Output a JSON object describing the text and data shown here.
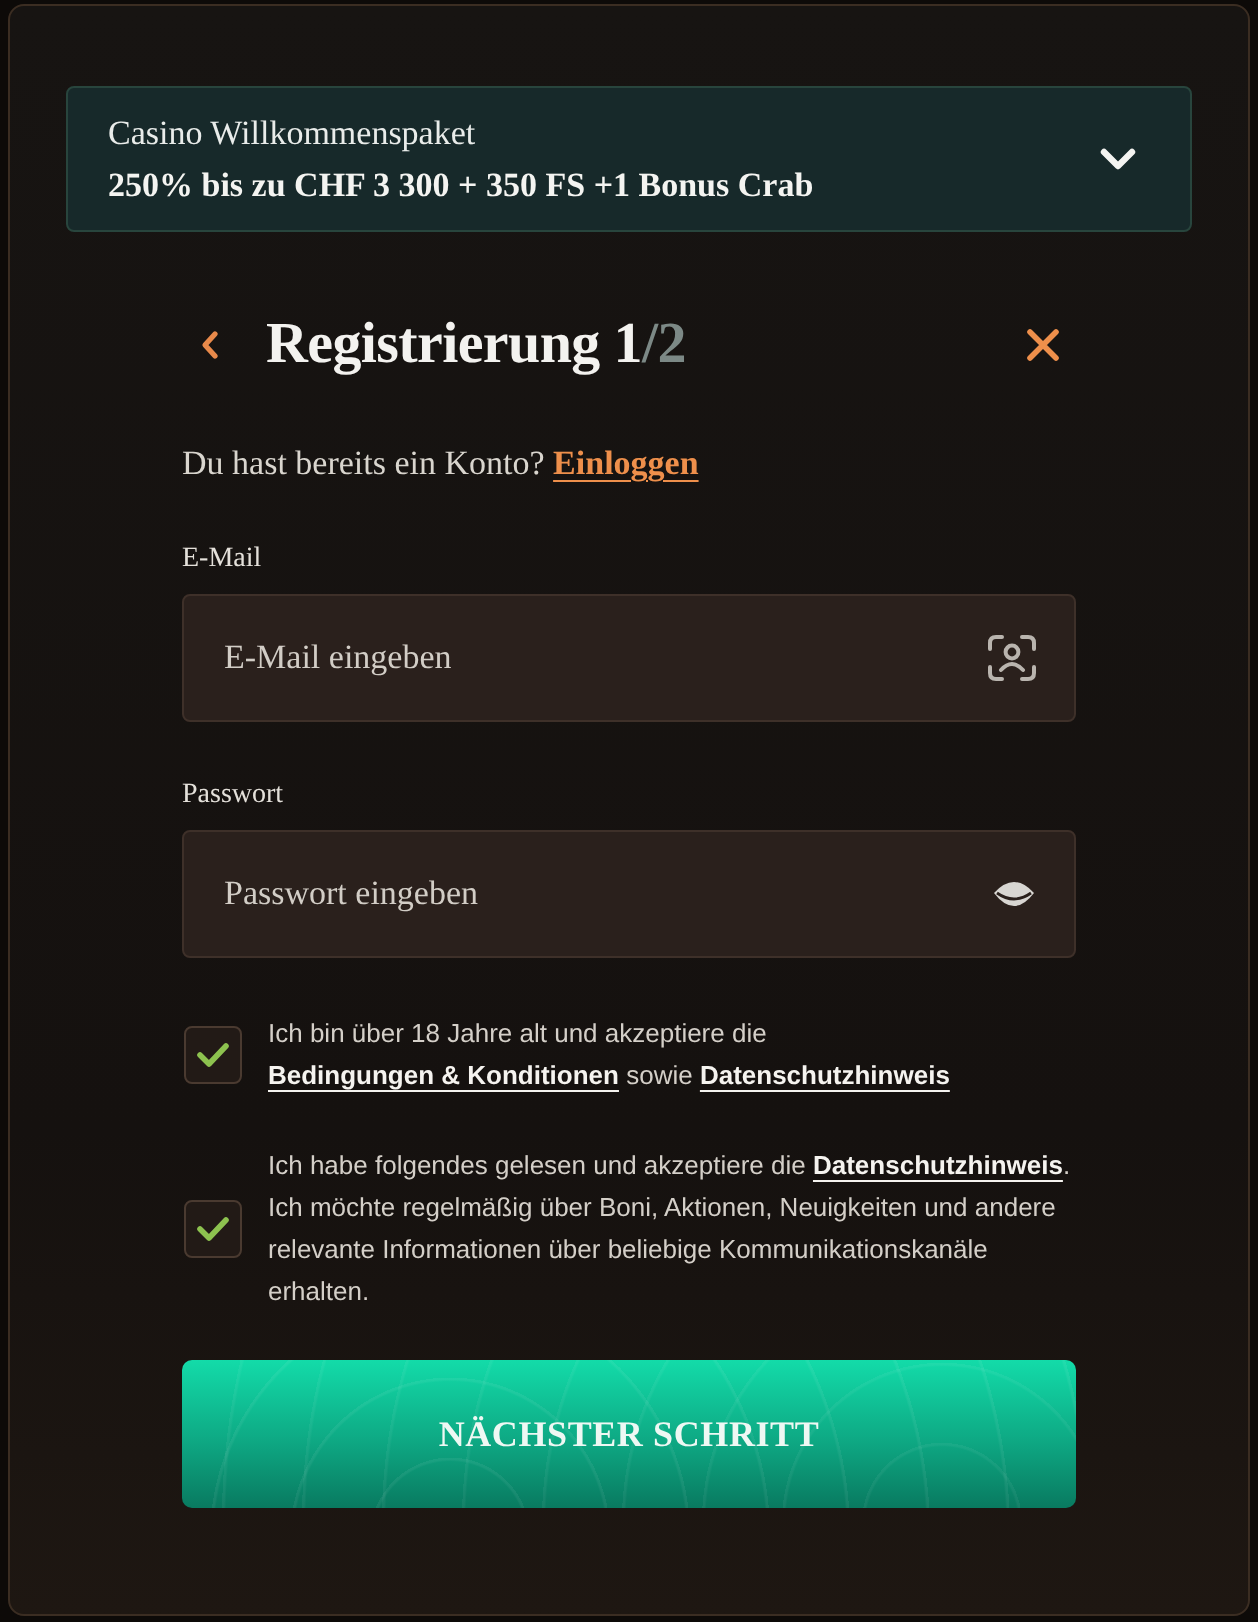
{
  "promo": {
    "title": "Casino Willkommenspaket",
    "offer": "250% bis zu CHF 3 300 + 350 FS +1 Bonus Crab",
    "expanded": false
  },
  "header": {
    "title": "Registrierung 1",
    "step_total": "/2"
  },
  "login_prompt": {
    "text": "Du hast bereits ein Konto? ",
    "link": "Einloggen"
  },
  "fields": [
    {
      "kind": "email",
      "label": "E-Mail",
      "placeholder": "E-Mail eingeben"
    },
    {
      "kind": "password",
      "label": "Passwort",
      "placeholder": "Passwort eingeben"
    }
  ],
  "consents": [
    {
      "checked": true,
      "parts": [
        {
          "kind": "text",
          "text": "Ich bin über 18 Jahre alt und akzeptiere die "
        },
        {
          "kind": "link",
          "text": "Bedingungen & Konditionen"
        },
        {
          "kind": "text",
          "text": " sowie "
        },
        {
          "kind": "link",
          "text": "Datenschutzhinweis"
        }
      ]
    },
    {
      "checked": true,
      "parts": [
        {
          "kind": "text",
          "text": "Ich habe folgendes gelesen und akzeptiere die "
        },
        {
          "kind": "link",
          "text": "Datenschutzhinweis"
        },
        {
          "kind": "text",
          "text": ". Ich möchte regelmäßig über Boni, Aktionen, Neuigkeiten und andere relevante Informationen über beliebige Kommunikationskanäle erhalten."
        }
      ]
    }
  ],
  "submit": {
    "label": "NÄCHSTER SCHRITT"
  }
}
